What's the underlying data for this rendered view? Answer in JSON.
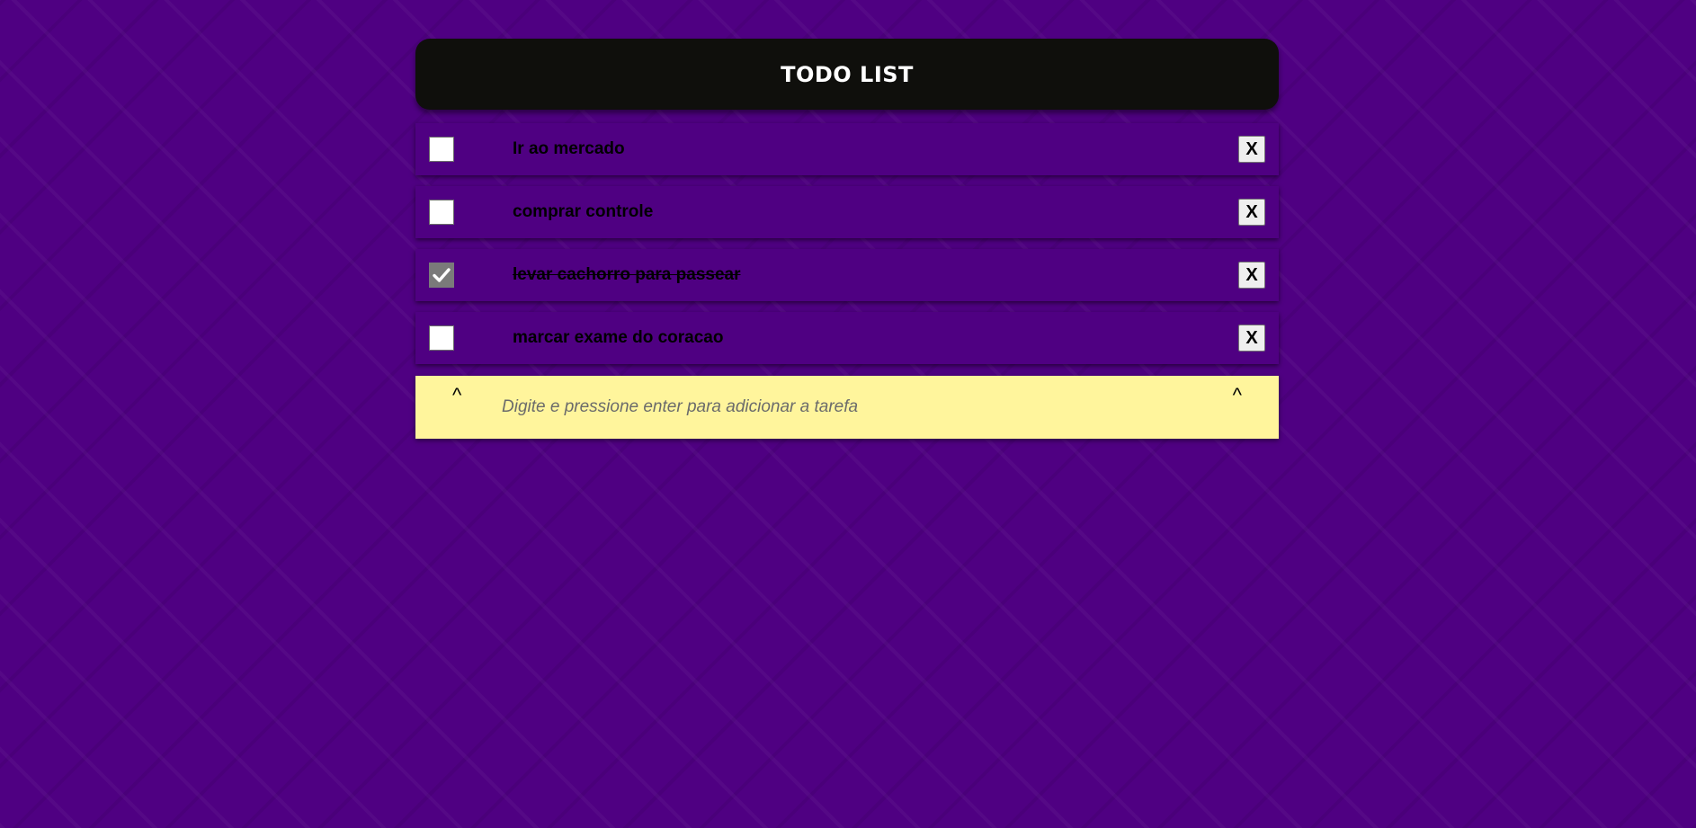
{
  "header": {
    "title": "TODO LIST"
  },
  "tasks": [
    {
      "text": "Ir ao mercado",
      "done": false,
      "delete_label": "X"
    },
    {
      "text": "comprar controle",
      "done": false,
      "delete_label": "X"
    },
    {
      "text": "levar cachorro para passear",
      "done": true,
      "delete_label": "X"
    },
    {
      "text": "marcar exame do coracao",
      "done": false,
      "delete_label": "X"
    }
  ],
  "add_bar": {
    "placeholder": "Digite e pressione enter para adicionar a tarefa",
    "value": "",
    "left_caret": "^",
    "right_caret": "^"
  },
  "colors": {
    "background": "#4f0082",
    "header_bg": "#0f0f0c",
    "add_bar_bg": "#fff59c",
    "checked_box": "#7a7a7a"
  }
}
